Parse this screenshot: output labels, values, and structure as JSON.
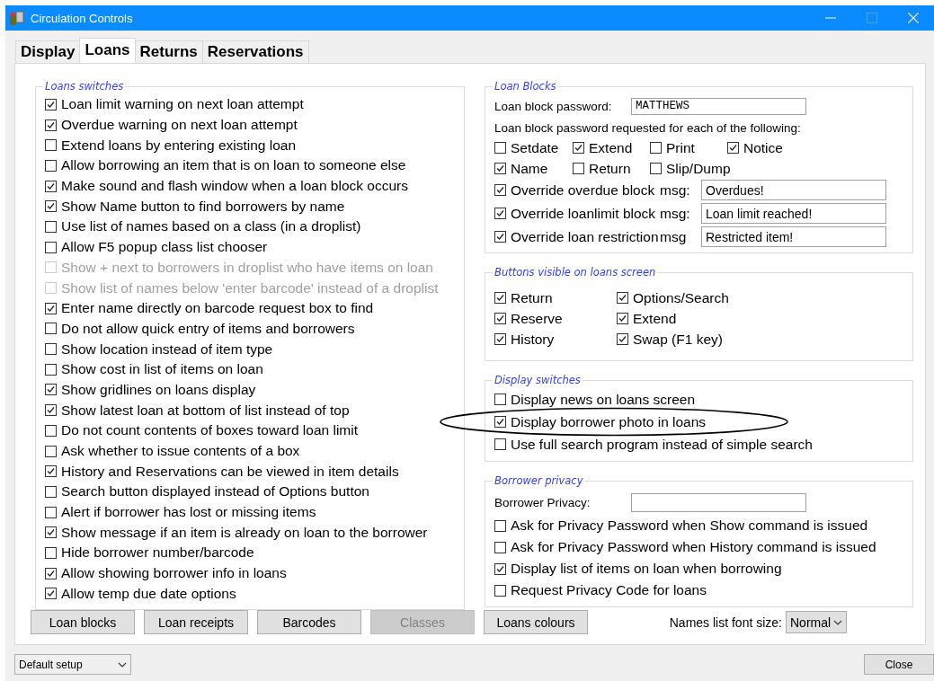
{
  "window": {
    "title": "Circulation Controls"
  },
  "tabs": [
    {
      "label": "Display",
      "selected": false
    },
    {
      "label": "Loans",
      "selected": true
    },
    {
      "label": "Returns",
      "selected": false
    },
    {
      "label": "Reservations",
      "selected": false
    }
  ],
  "loans_switches": {
    "title": "Loans switches",
    "items": [
      {
        "label": "Loan limit warning on next loan attempt",
        "checked": true,
        "disabled": false
      },
      {
        "label": "Overdue warning on next loan attempt",
        "checked": true,
        "disabled": false
      },
      {
        "label": "Extend loans by entering existing loan",
        "checked": false,
        "disabled": false
      },
      {
        "label": "Allow borrowing an item that is on loan to someone else",
        "checked": false,
        "disabled": false
      },
      {
        "label": "Make sound and flash window when a loan block occurs",
        "checked": true,
        "disabled": false
      },
      {
        "label": "Show Name button to find borrowers by name",
        "checked": true,
        "disabled": false
      },
      {
        "label": "Use list of names based on a class (in a droplist)",
        "checked": false,
        "disabled": false
      },
      {
        "label": "Allow F5 popup class list chooser",
        "checked": false,
        "disabled": false
      },
      {
        "label": "Show + next to borrowers in droplist who have items on loan",
        "checked": false,
        "disabled": true
      },
      {
        "label": "Show list of names below 'enter barcode' instead of a droplist",
        "checked": false,
        "disabled": true
      },
      {
        "label": "Enter name directly on barcode request box to find",
        "checked": true,
        "disabled": false
      },
      {
        "label": "Do not allow quick entry of items and borrowers",
        "checked": false,
        "disabled": false
      },
      {
        "label": "Show location instead of item type",
        "checked": false,
        "disabled": false
      },
      {
        "label": "Show cost in list of items on loan",
        "checked": false,
        "disabled": false
      },
      {
        "label": "Show gridlines on loans display",
        "checked": true,
        "disabled": false
      },
      {
        "label": "Show latest loan at bottom of list instead of top",
        "checked": true,
        "disabled": false
      },
      {
        "label": "Do not count contents of boxes toward loan limit",
        "checked": false,
        "disabled": false
      },
      {
        "label": "Ask whether to issue contents of a box",
        "checked": false,
        "disabled": false
      },
      {
        "label": "History and Reservations can be viewed in item details",
        "checked": true,
        "disabled": false
      },
      {
        "label": "Search button displayed instead of Options button",
        "checked": false,
        "disabled": false
      },
      {
        "label": "Alert if borrower has lost or missing items",
        "checked": false,
        "disabled": false
      },
      {
        "label": "Show message if an item is already on loan to the borrower",
        "checked": true,
        "disabled": false
      },
      {
        "label": "Hide borrower number/barcode",
        "checked": false,
        "disabled": false
      },
      {
        "label": "Allow showing borrower info in loans",
        "checked": true,
        "disabled": false
      },
      {
        "label": "Allow temp due date options",
        "checked": true,
        "disabled": false
      }
    ]
  },
  "loan_blocks": {
    "title": "Loan Blocks",
    "password_label": "Loan block password:",
    "password": "MATTHEWS",
    "requested_label": "Loan block password requested for each of the following:",
    "options": [
      {
        "label": "Setdate",
        "checked": false
      },
      {
        "label": "Extend",
        "checked": true
      },
      {
        "label": "Print",
        "checked": false
      },
      {
        "label": "Notice",
        "checked": true
      },
      {
        "label": "Name",
        "checked": true
      },
      {
        "label": "Return",
        "checked": false
      },
      {
        "label": "Slip/Dump",
        "checked": false
      }
    ],
    "overrides": [
      {
        "label": "Override overdue block",
        "checked": true,
        "msg_label": "msg:",
        "msg": "Overdues!"
      },
      {
        "label": "Override loanlimit block",
        "checked": true,
        "msg_label": "msg:",
        "msg": "Loan limit reached!"
      },
      {
        "label": "Override loan restriction",
        "checked": true,
        "msg_label": "msg",
        "msg": "Restricted item!"
      }
    ]
  },
  "buttons_visible": {
    "title": "Buttons visible on loans screen",
    "items": [
      {
        "label": "Return",
        "checked": true
      },
      {
        "label": "Options/Search",
        "checked": true
      },
      {
        "label": "Reserve",
        "checked": true
      },
      {
        "label": "Extend",
        "checked": true
      },
      {
        "label": "History",
        "checked": true
      },
      {
        "label": "Swap (F1 key)",
        "checked": true
      }
    ]
  },
  "display_switches": {
    "title": "Display switches",
    "items": [
      {
        "label": "Display news on loans screen",
        "checked": false,
        "circled": false
      },
      {
        "label": "Display borrower photo in loans",
        "checked": true,
        "circled": true
      },
      {
        "label": "Use full search program instead of simple search",
        "checked": false,
        "circled": false
      }
    ]
  },
  "borrower_privacy": {
    "title": "Borrower privacy",
    "field_label": "Borrower Privacy:",
    "items": [
      {
        "label": "Ask for Privacy Password when Show command is issued",
        "checked": false
      },
      {
        "label": "Ask for Privacy Password when History command is issued",
        "checked": false
      },
      {
        "label": "Display list of items on loan when borrowing",
        "checked": true
      },
      {
        "label": "Request Privacy Code for loans",
        "checked": false
      }
    ]
  },
  "action_buttons": [
    {
      "label": "Loan blocks",
      "disabled": false
    },
    {
      "label": "Loan receipts",
      "disabled": false
    },
    {
      "label": "Barcodes",
      "disabled": false
    },
    {
      "label": "Classes",
      "disabled": true
    },
    {
      "label": "Loans colours",
      "disabled": false
    }
  ],
  "font_size": {
    "label": "Names list font size:",
    "value": "Normal"
  },
  "setup": {
    "value": "Default setup"
  },
  "close_button": {
    "label": "Close"
  }
}
